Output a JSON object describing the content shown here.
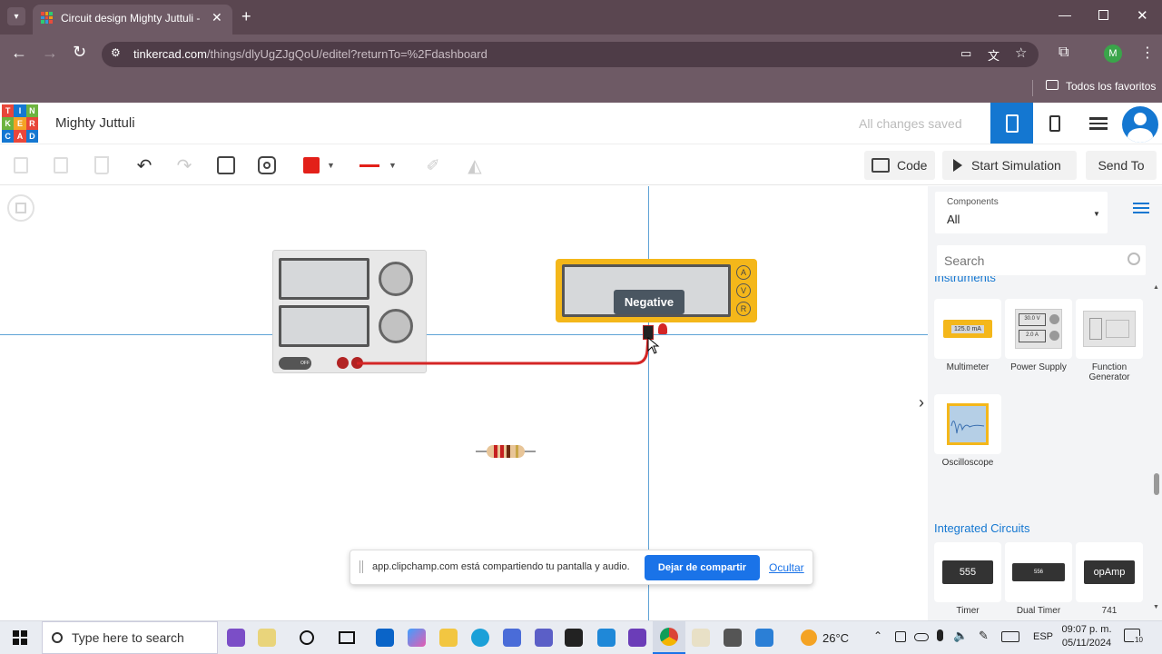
{
  "browser": {
    "tab_title": "Circuit design Mighty Juttuli - T",
    "url_domain": "tinkercad.com",
    "url_path": "/things/dlyUgZJgQoU/editel?returnTo=%2Fdashboard",
    "profile_initial": "M",
    "bookmarks_label": "Todos los favoritos"
  },
  "app": {
    "logo_letters": [
      "T",
      "I",
      "N",
      "K",
      "E",
      "R",
      "C",
      "A",
      "D"
    ],
    "design_name": "Mighty Juttuli",
    "save_status": "All changes saved"
  },
  "toolbar": {
    "code_label": "Code",
    "sim_label": "Start Simulation",
    "send_label": "Send To",
    "fill_color": "#e32019",
    "wire_color": "#e32019"
  },
  "canvas": {
    "tooltip": "Negative",
    "power_off_label": "OFF",
    "meter_modes": [
      "A",
      "V",
      "R"
    ]
  },
  "panel": {
    "components_label": "Components",
    "components_value": "All",
    "search_placeholder": "Search",
    "section_instruments": "Instruments",
    "instruments": [
      {
        "label": "Multimeter",
        "icon": "multimeter-icon",
        "display": "125.0 mA"
      },
      {
        "label": "Power Supply",
        "icon": "power-supply-icon",
        "display1": "30.0 V",
        "display2": "2.0 A"
      },
      {
        "label": "Function Generator",
        "icon": "function-generator-icon"
      },
      {
        "label": "Oscilloscope",
        "icon": "oscilloscope-icon"
      }
    ],
    "section_ic": "Integrated Circuits",
    "ics": [
      {
        "label": "Timer",
        "chip": "555"
      },
      {
        "label": "Dual Timer",
        "chip": "556"
      },
      {
        "label": "741",
        "chip": "opAmp"
      }
    ]
  },
  "share_bar": {
    "message": "app.clipchamp.com está compartiendo tu pantalla y audio.",
    "stop_label": "Dejar de compartir",
    "hide_label": "Ocultar"
  },
  "taskbar": {
    "search_placeholder": "Type here to search",
    "weather": "26°C",
    "lang": "ESP",
    "time": "09:07 p. m.",
    "date": "05/11/2024",
    "notif_count": "10"
  }
}
